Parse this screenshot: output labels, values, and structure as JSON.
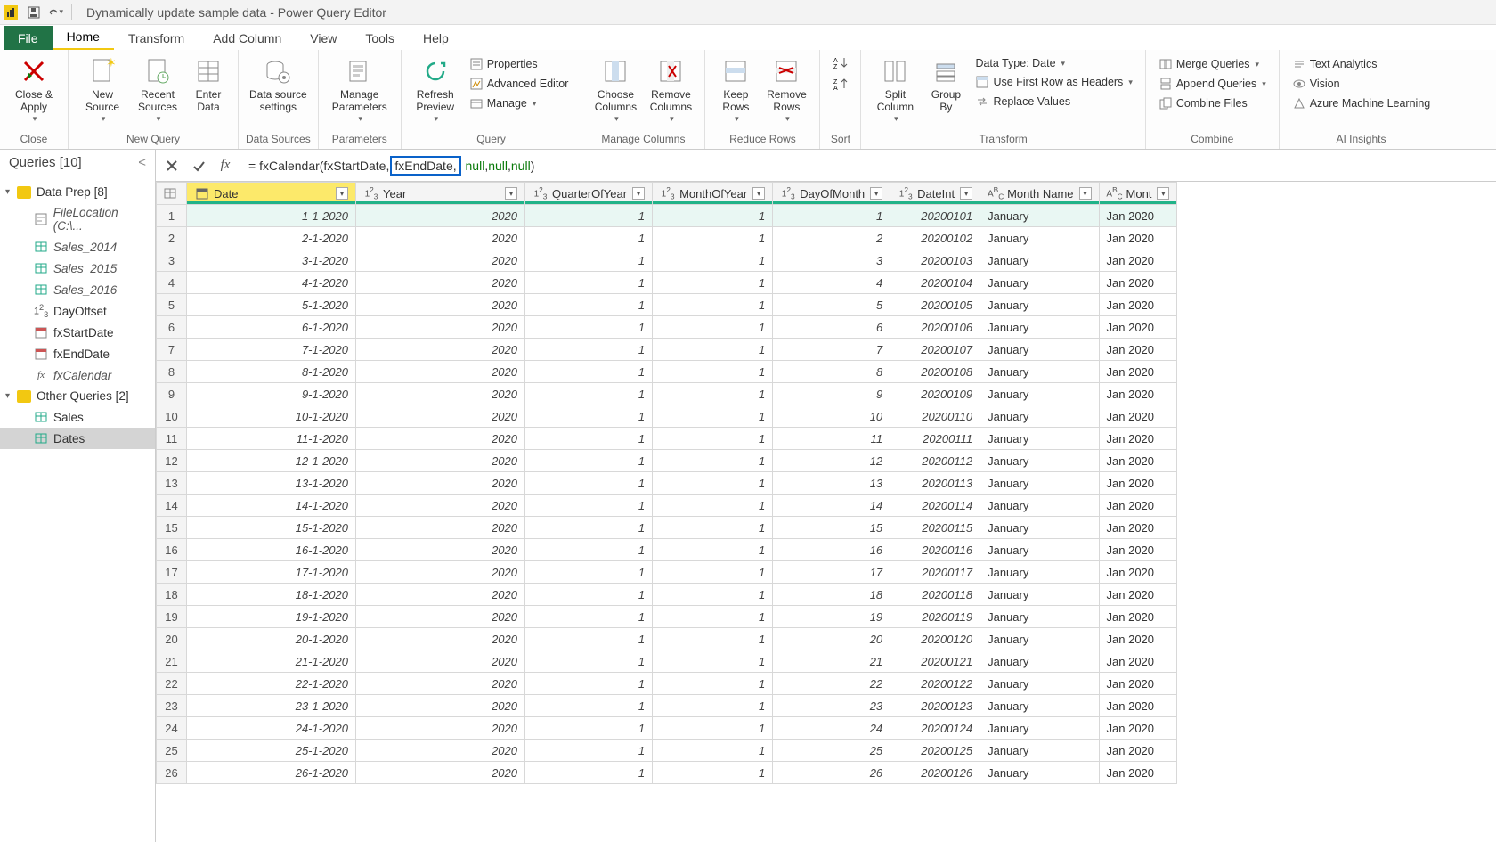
{
  "title_bar": {
    "title": "Dynamically update sample data - Power Query Editor"
  },
  "menu_tabs": {
    "file": "File",
    "home": "Home",
    "transform": "Transform",
    "add_column": "Add Column",
    "view": "View",
    "tools": "Tools",
    "help": "Help"
  },
  "ribbon": {
    "close": {
      "close_apply": "Close &\nApply",
      "group": "Close"
    },
    "newquery": {
      "new_source": "New\nSource",
      "recent_sources": "Recent\nSources",
      "enter_data": "Enter\nData",
      "group": "New Query"
    },
    "datasources": {
      "settings": "Data source\nsettings",
      "group": "Data Sources"
    },
    "parameters": {
      "manage": "Manage\nParameters",
      "group": "Parameters"
    },
    "query": {
      "refresh": "Refresh\nPreview",
      "properties": "Properties",
      "adv_editor": "Advanced Editor",
      "manage": "Manage",
      "group": "Query"
    },
    "manage_cols": {
      "choose": "Choose\nColumns",
      "remove": "Remove\nColumns",
      "group": "Manage Columns"
    },
    "reduce_rows": {
      "keep": "Keep\nRows",
      "remove": "Remove\nRows",
      "group": "Reduce Rows"
    },
    "sort": {
      "group": "Sort"
    },
    "transform": {
      "split": "Split\nColumn",
      "groupby": "Group\nBy",
      "datatype": "Data Type: Date",
      "firstrow": "Use First Row as Headers",
      "replace": "Replace Values",
      "group": "Transform"
    },
    "combine": {
      "merge": "Merge Queries",
      "append": "Append Queries",
      "combine_files": "Combine Files",
      "group": "Combine"
    },
    "ai": {
      "text": "Text Analytics",
      "vision": "Vision",
      "azure": "Azure Machine Learning",
      "group": "AI Insights"
    }
  },
  "queries_panel": {
    "header": "Queries [10]",
    "folders": [
      {
        "name": "Data Prep [8]",
        "items": [
          {
            "name": "FileLocation (C:\\...",
            "type": "param",
            "italic": true
          },
          {
            "name": "Sales_2014",
            "type": "table",
            "italic": true
          },
          {
            "name": "Sales_2015",
            "type": "table",
            "italic": true
          },
          {
            "name": "Sales_2016",
            "type": "table",
            "italic": true
          },
          {
            "name": "DayOffset",
            "type": "num"
          },
          {
            "name": "fxStartDate",
            "type": "date"
          },
          {
            "name": "fxEndDate",
            "type": "date"
          },
          {
            "name": "fxCalendar",
            "type": "fx",
            "italic": true
          }
        ]
      },
      {
        "name": "Other Queries [2]",
        "items": [
          {
            "name": "Sales",
            "type": "table"
          },
          {
            "name": "Dates",
            "type": "table",
            "selected": true
          }
        ]
      }
    ]
  },
  "formula_bar": {
    "prefix": "= fxCalendar(fxStartDate, ",
    "highlight": "fxEndDate,",
    "null1": "null",
    "comma1": ", ",
    "null2": "null",
    "comma2": ", ",
    "null3": "null",
    "suffix": ")"
  },
  "grid": {
    "columns": [
      {
        "key": "date",
        "label": "Date",
        "type": "date",
        "highlighted": true
      },
      {
        "key": "year",
        "label": "Year",
        "type": "num"
      },
      {
        "key": "quarter",
        "label": "QuarterOfYear",
        "type": "num"
      },
      {
        "key": "month",
        "label": "MonthOfYear",
        "type": "num"
      },
      {
        "key": "day",
        "label": "DayOfMonth",
        "type": "num"
      },
      {
        "key": "dateint",
        "label": "DateInt",
        "type": "num"
      },
      {
        "key": "monthname",
        "label": "Month Name",
        "type": "text"
      },
      {
        "key": "monthshort",
        "label": "Mont",
        "type": "text"
      }
    ],
    "rows": [
      {
        "n": 1,
        "date": "1-1-2020",
        "year": "2020",
        "quarter": "1",
        "month": "1",
        "day": "1",
        "dateint": "20200101",
        "monthname": "January",
        "monthshort": "Jan 2020"
      },
      {
        "n": 2,
        "date": "2-1-2020",
        "year": "2020",
        "quarter": "1",
        "month": "1",
        "day": "2",
        "dateint": "20200102",
        "monthname": "January",
        "monthshort": "Jan 2020"
      },
      {
        "n": 3,
        "date": "3-1-2020",
        "year": "2020",
        "quarter": "1",
        "month": "1",
        "day": "3",
        "dateint": "20200103",
        "monthname": "January",
        "monthshort": "Jan 2020"
      },
      {
        "n": 4,
        "date": "4-1-2020",
        "year": "2020",
        "quarter": "1",
        "month": "1",
        "day": "4",
        "dateint": "20200104",
        "monthname": "January",
        "monthshort": "Jan 2020"
      },
      {
        "n": 5,
        "date": "5-1-2020",
        "year": "2020",
        "quarter": "1",
        "month": "1",
        "day": "5",
        "dateint": "20200105",
        "monthname": "January",
        "monthshort": "Jan 2020"
      },
      {
        "n": 6,
        "date": "6-1-2020",
        "year": "2020",
        "quarter": "1",
        "month": "1",
        "day": "6",
        "dateint": "20200106",
        "monthname": "January",
        "monthshort": "Jan 2020"
      },
      {
        "n": 7,
        "date": "7-1-2020",
        "year": "2020",
        "quarter": "1",
        "month": "1",
        "day": "7",
        "dateint": "20200107",
        "monthname": "January",
        "monthshort": "Jan 2020"
      },
      {
        "n": 8,
        "date": "8-1-2020",
        "year": "2020",
        "quarter": "1",
        "month": "1",
        "day": "8",
        "dateint": "20200108",
        "monthname": "January",
        "monthshort": "Jan 2020"
      },
      {
        "n": 9,
        "date": "9-1-2020",
        "year": "2020",
        "quarter": "1",
        "month": "1",
        "day": "9",
        "dateint": "20200109",
        "monthname": "January",
        "monthshort": "Jan 2020"
      },
      {
        "n": 10,
        "date": "10-1-2020",
        "year": "2020",
        "quarter": "1",
        "month": "1",
        "day": "10",
        "dateint": "20200110",
        "monthname": "January",
        "monthshort": "Jan 2020"
      },
      {
        "n": 11,
        "date": "11-1-2020",
        "year": "2020",
        "quarter": "1",
        "month": "1",
        "day": "11",
        "dateint": "20200111",
        "monthname": "January",
        "monthshort": "Jan 2020"
      },
      {
        "n": 12,
        "date": "12-1-2020",
        "year": "2020",
        "quarter": "1",
        "month": "1",
        "day": "12",
        "dateint": "20200112",
        "monthname": "January",
        "monthshort": "Jan 2020"
      },
      {
        "n": 13,
        "date": "13-1-2020",
        "year": "2020",
        "quarter": "1",
        "month": "1",
        "day": "13",
        "dateint": "20200113",
        "monthname": "January",
        "monthshort": "Jan 2020"
      },
      {
        "n": 14,
        "date": "14-1-2020",
        "year": "2020",
        "quarter": "1",
        "month": "1",
        "day": "14",
        "dateint": "20200114",
        "monthname": "January",
        "monthshort": "Jan 2020"
      },
      {
        "n": 15,
        "date": "15-1-2020",
        "year": "2020",
        "quarter": "1",
        "month": "1",
        "day": "15",
        "dateint": "20200115",
        "monthname": "January",
        "monthshort": "Jan 2020"
      },
      {
        "n": 16,
        "date": "16-1-2020",
        "year": "2020",
        "quarter": "1",
        "month": "1",
        "day": "16",
        "dateint": "20200116",
        "monthname": "January",
        "monthshort": "Jan 2020"
      },
      {
        "n": 17,
        "date": "17-1-2020",
        "year": "2020",
        "quarter": "1",
        "month": "1",
        "day": "17",
        "dateint": "20200117",
        "monthname": "January",
        "monthshort": "Jan 2020"
      },
      {
        "n": 18,
        "date": "18-1-2020",
        "year": "2020",
        "quarter": "1",
        "month": "1",
        "day": "18",
        "dateint": "20200118",
        "monthname": "January",
        "monthshort": "Jan 2020"
      },
      {
        "n": 19,
        "date": "19-1-2020",
        "year": "2020",
        "quarter": "1",
        "month": "1",
        "day": "19",
        "dateint": "20200119",
        "monthname": "January",
        "monthshort": "Jan 2020"
      },
      {
        "n": 20,
        "date": "20-1-2020",
        "year": "2020",
        "quarter": "1",
        "month": "1",
        "day": "20",
        "dateint": "20200120",
        "monthname": "January",
        "monthshort": "Jan 2020"
      },
      {
        "n": 21,
        "date": "21-1-2020",
        "year": "2020",
        "quarter": "1",
        "month": "1",
        "day": "21",
        "dateint": "20200121",
        "monthname": "January",
        "monthshort": "Jan 2020"
      },
      {
        "n": 22,
        "date": "22-1-2020",
        "year": "2020",
        "quarter": "1",
        "month": "1",
        "day": "22",
        "dateint": "20200122",
        "monthname": "January",
        "monthshort": "Jan 2020"
      },
      {
        "n": 23,
        "date": "23-1-2020",
        "year": "2020",
        "quarter": "1",
        "month": "1",
        "day": "23",
        "dateint": "20200123",
        "monthname": "January",
        "monthshort": "Jan 2020"
      },
      {
        "n": 24,
        "date": "24-1-2020",
        "year": "2020",
        "quarter": "1",
        "month": "1",
        "day": "24",
        "dateint": "20200124",
        "monthname": "January",
        "monthshort": "Jan 2020"
      },
      {
        "n": 25,
        "date": "25-1-2020",
        "year": "2020",
        "quarter": "1",
        "month": "1",
        "day": "25",
        "dateint": "20200125",
        "monthname": "January",
        "monthshort": "Jan 2020"
      },
      {
        "n": 26,
        "date": "26-1-2020",
        "year": "2020",
        "quarter": "1",
        "month": "1",
        "day": "26",
        "dateint": "20200126",
        "monthname": "January",
        "monthshort": "Jan 2020"
      }
    ]
  }
}
